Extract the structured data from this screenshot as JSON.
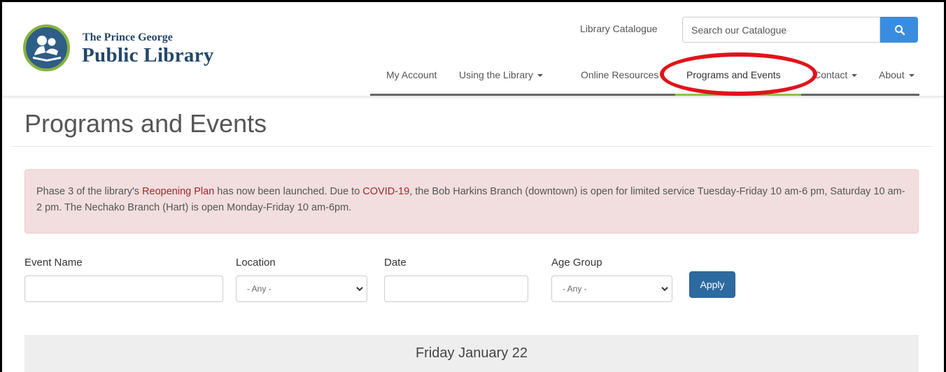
{
  "header": {
    "logo_line1": "The Prince George",
    "logo_line2": "Public Library",
    "catalogue_link": "Library Catalogue",
    "search_placeholder": "Search our Catalogue"
  },
  "nav": {
    "items": [
      {
        "label": "My Account",
        "dropdown": false
      },
      {
        "label": "Using the Library",
        "dropdown": true
      },
      {
        "label": "Online Resources",
        "dropdown": false
      },
      {
        "label": "Programs and Events",
        "dropdown": false,
        "active": true
      },
      {
        "label": "Contact",
        "dropdown": true
      },
      {
        "label": "About",
        "dropdown": true
      }
    ]
  },
  "page": {
    "title": "Programs and Events"
  },
  "alert": {
    "text_1": "Phase 3 of the library's ",
    "link_1": "Reopening Plan",
    "text_2": " has now been launched. Due to ",
    "link_2": "COVID-19",
    "text_3": ", the Bob Harkins Branch (downtown) is open for limited service Tuesday-Friday 10 am-6 pm, Saturday 10 am-2 pm. The Nechako Branch (Hart) is open Monday-Friday 10 am-6pm."
  },
  "filters": {
    "event_name_label": "Event Name",
    "event_name_value": "",
    "location_label": "Location",
    "location_value": "- Any -",
    "date_label": "Date",
    "date_value": "",
    "age_group_label": "Age Group",
    "age_group_value": "- Any -",
    "apply_label": "Apply"
  },
  "events": {
    "day_heading": "Friday January 22"
  },
  "colors": {
    "brand_navy": "#23476a",
    "brand_green": "#86b33d",
    "search_button": "#3a8dde",
    "apply_button": "#2d6aa0",
    "alert_bg": "#f2dede",
    "alert_link": "#a3252a",
    "annotation_red": "#e0141a",
    "active_underline": "#8bc34a"
  },
  "icons": {
    "logo": "reading-person-icon",
    "search": "search-icon",
    "dropdown": "caret-down-icon",
    "select": "chevron-down-icon"
  }
}
